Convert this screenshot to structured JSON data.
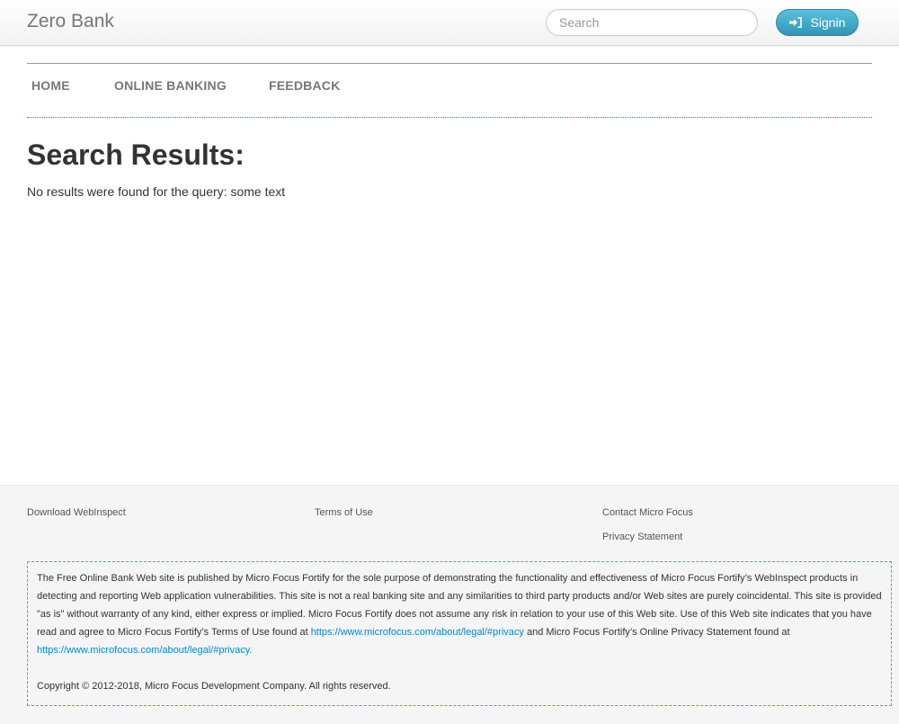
{
  "header": {
    "brand": "Zero Bank",
    "search_placeholder": "Search",
    "signin_label": "Signin"
  },
  "nav": {
    "items": [
      "HOME",
      "ONLINE BANKING",
      "FEEDBACK"
    ]
  },
  "main": {
    "title": "Search Results:",
    "message": "No results were found for the query: some text"
  },
  "footer": {
    "links": {
      "download": "Download WebInspect",
      "terms": "Terms of Use",
      "contact": "Contact Micro Focus",
      "privacy": "Privacy Statement"
    },
    "disclaimer": {
      "text_1": "The Free Online Bank Web site is published by Micro Focus Fortify for the sole purpose of demonstrating the functionality and effectiveness of Micro Focus Fortify’s WebInspect products in detecting and reporting Web application vulnerabilities. This site is not a real banking site and any similarities to third party products and/or Web sites are purely coincidental. This site is provided \"as is\" without warranty of any kind, either express or implied. Micro Focus Fortify does not assume any risk in relation to your use of this Web site. Use of this Web site indicates that you have read and agree to Micro Focus Fortify’s Terms of Use found at ",
      "link_1": "https://www.microfocus.com/about/legal/#privacy",
      "text_2": " and Micro Focus Fortify’s Online Privacy Statement found at ",
      "link_2": "https://www.microfocus.com/about/legal/#privacy.",
      "copyright": "Copyright © 2012-2018, Micro Focus Development Company. All rights reserved."
    }
  },
  "colors": {
    "accent": "#0088cc",
    "signin_button": "#49afcd"
  },
  "icons": {
    "signin": "sign-in-icon"
  }
}
